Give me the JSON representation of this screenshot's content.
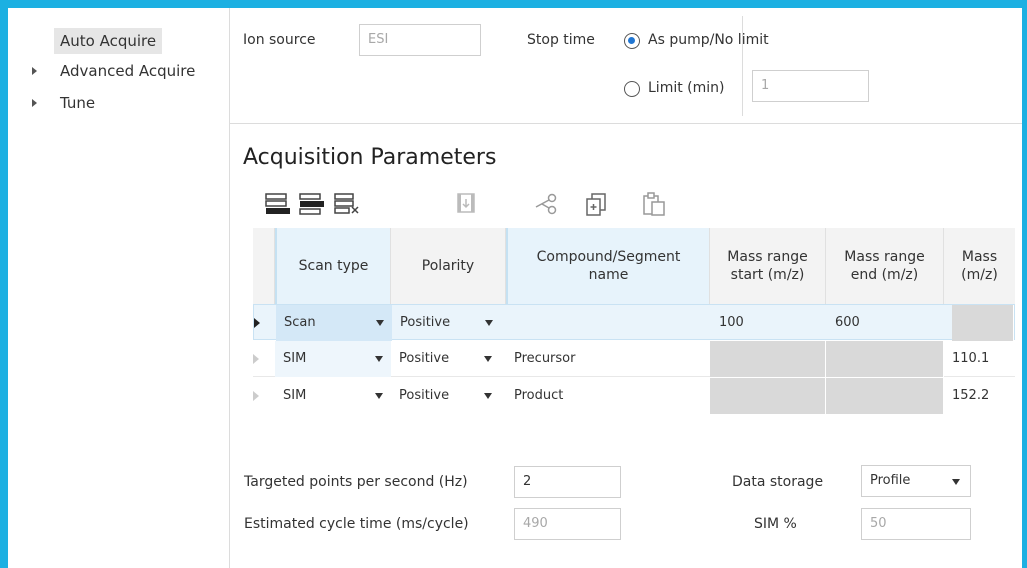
{
  "tree": {
    "items": [
      {
        "label": "Auto Acquire",
        "selected": true,
        "expandable": false
      },
      {
        "label": "Advanced Acquire",
        "selected": false,
        "expandable": true
      },
      {
        "label": "Tune",
        "selected": false,
        "expandable": true
      }
    ]
  },
  "ion_source": {
    "label": "Ion source",
    "value": "ESI"
  },
  "stop_time": {
    "label": "Stop time",
    "option_pump": "As pump/No limit",
    "option_limit": "Limit (min)",
    "limit_value": "1",
    "selected": "pump"
  },
  "acquisition": {
    "title": "Acquisition Parameters",
    "toolbar": [
      "add-row-icon",
      "insert-row-icon",
      "delete-row-icon",
      "move-down-icon",
      "cut-icon",
      "copy-icon",
      "paste-icon"
    ],
    "columns": [
      "Scan type",
      "Polarity",
      "Compound/Segment name",
      "Mass range start (m/z)",
      "Mass range end (m/z)",
      "Mass (m/z)"
    ],
    "rows": [
      {
        "scan_type": "Scan",
        "polarity": "Positive",
        "name": "",
        "start": "100",
        "end": "600",
        "mass": ""
      },
      {
        "scan_type": "SIM",
        "polarity": "Positive",
        "name": "Precursor",
        "start": "",
        "end": "",
        "mass": "110.1"
      },
      {
        "scan_type": "SIM",
        "polarity": "Positive",
        "name": "Product",
        "start": "",
        "end": "",
        "mass": "152.2"
      }
    ]
  },
  "settings": {
    "targeted_label": "Targeted points per second (Hz)",
    "targeted_value": "2",
    "cycle_label": "Estimated cycle time (ms/cycle)",
    "cycle_value": "490",
    "storage_label": "Data storage",
    "storage_value": "Profile",
    "sim_label": "SIM %",
    "sim_value": "50"
  },
  "colors": {
    "accent": "#1cb0e2",
    "radio": "#2176d2",
    "header_selected": "#e7f3fb",
    "disabled_cell": "#d9d9d9"
  }
}
